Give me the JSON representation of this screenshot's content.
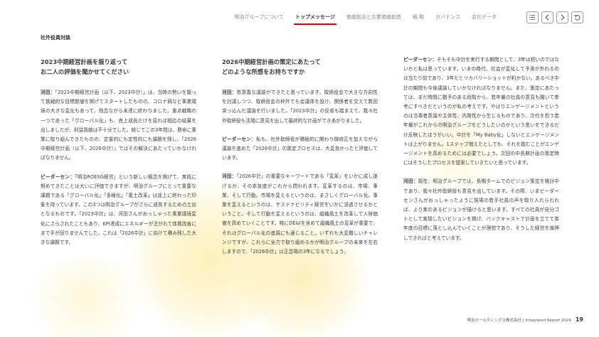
{
  "nav": {
    "items": [
      {
        "label": "明治グループについて",
        "active": false
      },
      {
        "label": "トップメッセージ",
        "active": true
      },
      {
        "label": "価値創出と企業価値創造",
        "active": false
      },
      {
        "label": "戦 略",
        "active": false
      },
      {
        "label": "ガバナンス",
        "active": false
      },
      {
        "label": "会社データ",
        "active": false
      }
    ],
    "icons": [
      "list-icon",
      "prev-page-icon",
      "next-page-icon",
      "back-icon"
    ]
  },
  "section_title": "社外役員対談",
  "col1": {
    "question": [
      "2023中期経営計画を振り返って",
      "お二人の評価を聞かせてください"
    ],
    "paras": [
      {
        "speaker": "河田：",
        "text": "「2023中期経営計画（以下、2023中計）」は、当時の勢いを駆って挑戦的な目標数値を掲げてスタートしたものの、コロナ禍など事業環境の大きな変化もあって、残念ながら未達に終わりました。重点戦略の一つであった「グローバル化」も、売上成長だけを見れば相応の結果を出しましたが、利益貢献は不十分でした。総じてこの3年間は、懸命に事業に取り組んできたものの、定量的にも定性的にも課題を残し、「2026中期経営計画（以下、2026中計）」ではその解決にあたっていかなければなりません。"
      },
      {
        "speaker": "ピーダーセン：",
        "text": "「明治ROESG経営」という新しい概念を掲げて、実践に努めてきたことは大いに評価できますが、明治グループにとって重要な課題である「グローバル化」「多様化」「風土改革」は途上に終わった印象を持っています。この3つは明治グループがさらに成長するための土台となるものです。「2023中計」は、河田さんがおっしゃった事業環境変化にさらされたこともあり、KPI達成にエネルギーが注がれて体質改善にまで手が回りませんでした。これは「2026中計」に向けて積み残した大きな課題です。"
      }
    ]
  },
  "col2": {
    "question": [
      "2026中期経営計画の策定にあたって",
      "どのような所感をお持ちですか"
    ],
    "paras": [
      {
        "speaker": "河田：",
        "text": "有意義な議論ができたと思っています。取締役会で大きな方向性を討議しつつ、取締役会の枠外でも会議体を設け、関係者を交えて数回突っ込んだ議論を行いました。「2023中計」の反省も踏まえて、我々社外取締役も活発に意見を出して最終的な計画ができあがりました。"
      },
      {
        "speaker": "ピーダーセン：",
        "text": "私も、社外取締役が積極的に関わり微修正を加えながら議論を進めた「2026中計」の策定プロセスは、大変良かったと評価しています。"
      },
      {
        "speaker": "河田：",
        "text": "「2026中計」の重要なキーワードである「変革」をいかに成し遂げるか、その本気度がこれから問われます。変革するのは、市場、事業、そして行動。市場を変えるというのは、まさしくグローバル化。事業を変えるというのは、サステナビリティ経営をいかに浸透させるかということ。そして行動を変えるというのは、組織風土を改革して人財価値を高めていくことです。特にDE&Iを含めて組織風土の変革が重要で、それはグローバル化の進展にも通じること。いずれも大変難しいチャレンジですが、これらに全力で取り組めるかが明治グループの未来を左右しますので、「2026中計」は正念場の3年になるでしょう。"
      }
    ]
  },
  "col3": {
    "paras": [
      {
        "speaker": "ピーダーセン：",
        "text": "そもそも中計を実行する期間として、3年は短いのではないかと私は思っています。いまの時代、社会が変化して予測が外れるのは当たり前であり、3年だとリカバリーショットが利かない。あるべき中計の期間も今後議論していかなければなりません。また、策定にあたっては、まだ時間に猶予のある段階から、若年層の社員の意見も聞いて参考にすべきだというのが私の考えです。やはりエンゲージメントというのは当事者意識や主体性、内発性から生じるものであり、次代を担う若年層がこれからの明治グループをどうしたいのかという思いをできるだけ反映したほうがいい。中計を「My Baby化」しないとエンゲージメントは上がりません。1ステップ増えたとしても、それを踏むことがエンゲージメントを高めるためには必要でしょう。次回の中長期計画の策定時にはそうしたプロセスを提案していきたいと思っています。"
      },
      {
        "speaker": "河田：",
        "text": "現在、明治グループでは、長期タームでのビジョン策定を検討中であり、我々社外取締役も意見を出しています。その際、いまピーダーセンさんがおっしゃったように現場の若手社員の声を取り入れられれば、より実のあるビジョンが描けると思います。すべての社員が自分ゴトとして実現したいビジョンを掲げ、バックキャストで計画を立てて単年度の目標に落とし込んでいくことが理想であり、そうした経営を後押しできればと考えています。"
      }
    ]
  },
  "footer": {
    "company": "明治ホールディングス株式会社 | Integrated Report 2024",
    "page": "19"
  },
  "colors": {
    "accent_underline": "#d7000f",
    "splash": "#fce482"
  }
}
